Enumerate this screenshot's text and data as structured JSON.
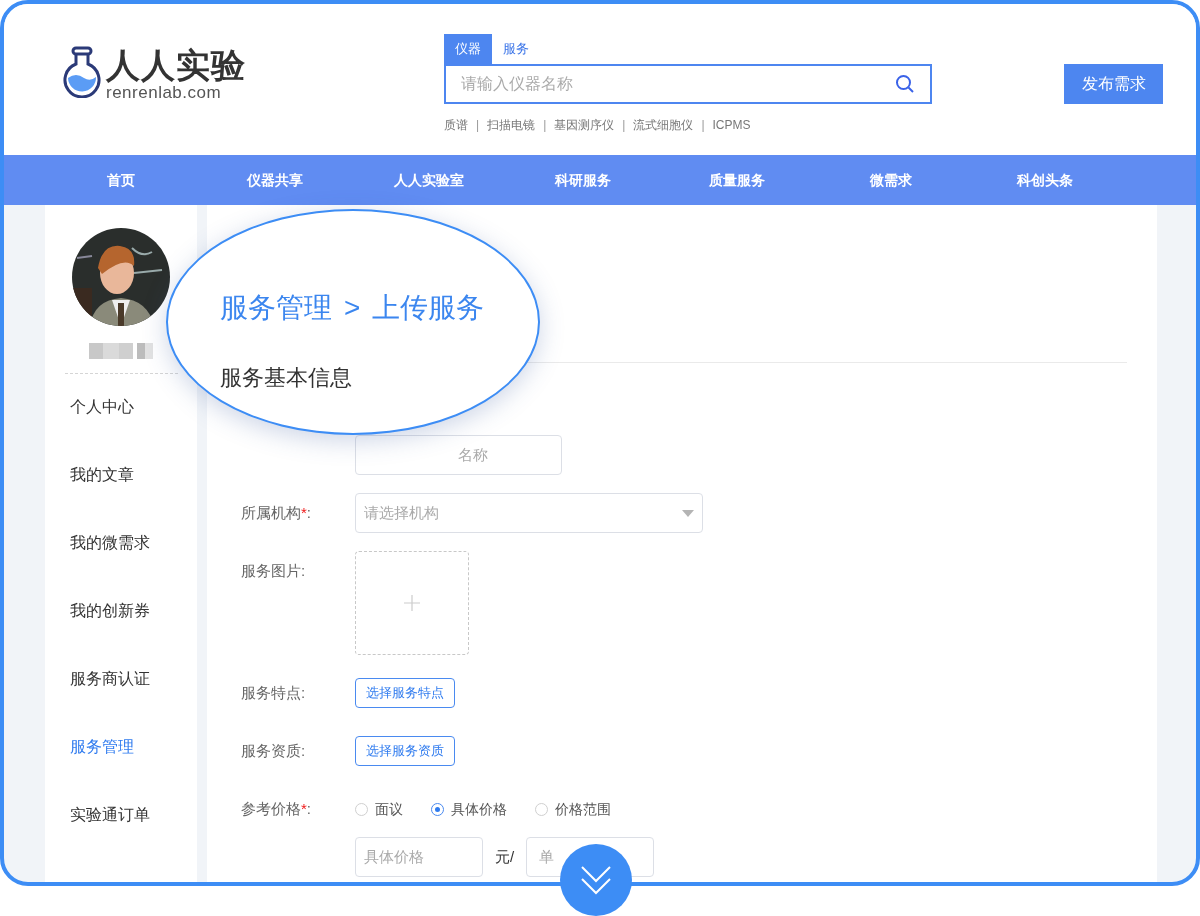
{
  "logo": {
    "name": "人人实验",
    "domain": "renrenlab.com"
  },
  "search": {
    "tabs": [
      {
        "label": "仪器",
        "selected": true
      },
      {
        "label": "服务",
        "selected": false
      }
    ],
    "placeholder": "请输入仪器名称",
    "hot_separator": "|",
    "hot": [
      "质谱",
      "扫描电镜",
      "基因测序仪",
      "流式细胞仪",
      "ICPMS"
    ]
  },
  "publish_button": "发布需求",
  "nav": [
    "首页",
    "仪器共享",
    "人人实验室",
    "科研服务",
    "质量服务",
    "微需求",
    "科创头条"
  ],
  "sidebar": {
    "items": [
      {
        "label": "个人中心",
        "selected": false
      },
      {
        "label": "我的文章",
        "selected": false
      },
      {
        "label": "我的微需求",
        "selected": false
      },
      {
        "label": "我的创新券",
        "selected": false
      },
      {
        "label": "服务商认证",
        "selected": false
      },
      {
        "label": "服务管理",
        "selected": true
      },
      {
        "label": "实验通订单",
        "selected": false
      }
    ]
  },
  "lens": {
    "breadcrumb": [
      "服务管理",
      "上传服务"
    ],
    "separator": ">",
    "section_title": "服务基本信息"
  },
  "form": {
    "required_mark": "*",
    "colon": ":",
    "first_field_placeholder": "名称",
    "rows": [
      {
        "kind": "select",
        "label": "所属机构",
        "required": true,
        "placeholder": "请选择机构"
      },
      {
        "kind": "upload",
        "label": "服务图片",
        "required": false
      },
      {
        "kind": "button",
        "label": "服务特点",
        "required": false,
        "button": "选择服务特点"
      },
      {
        "kind": "button",
        "label": "服务资质",
        "required": false,
        "button": "选择服务资质"
      },
      {
        "kind": "radio",
        "label": "参考价格",
        "required": true,
        "options": [
          {
            "label": "面议",
            "selected": false
          },
          {
            "label": "具体价格",
            "selected": true
          },
          {
            "label": "价格范围",
            "selected": false
          }
        ]
      }
    ],
    "price": {
      "placeholder": "具体价格",
      "unit": "元/",
      "unit_placeholder": "单"
    }
  }
}
